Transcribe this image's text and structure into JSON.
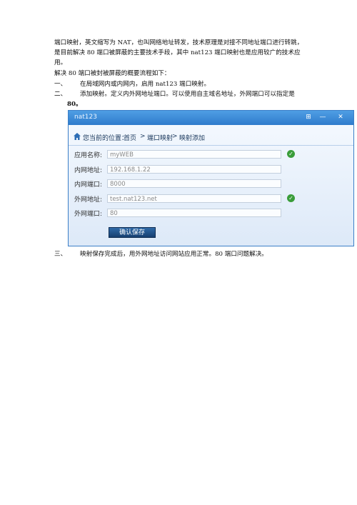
{
  "document": {
    "paragraphs": [
      "端口映射，英文缩写为 NAT，也叫网络地址转发，技术原理是对接不同地址端口进行转跳，",
      "是目前解决 80 端口被屏蔽的主要技术手段，其中 nat123 端口映射也是应用较广的技术应",
      "用。",
      "解决 80 端口被封被屏蔽的概要流程如下："
    ],
    "steps": [
      {
        "num": "一、",
        "text": "在局域网内或内网内，启用 nat123 端口映射。"
      },
      {
        "num": "二、",
        "text": "添加映射。定义内外网地址端口。可以使用自主域名地址，外网端口可以指定是",
        "cont": "80。"
      },
      {
        "num": "三、",
        "text": "映射保存完成后，用外网地址访问网站应用正常。80 端口问题解决。"
      }
    ]
  },
  "window": {
    "title": "nat123",
    "breadcrumb": {
      "prefix": "您当前的位置：",
      "items": [
        "首页",
        "端口映射",
        "映射添加"
      ],
      "separator": ">"
    },
    "form": {
      "fields": [
        {
          "label": "应用名称:",
          "value": "myWEB",
          "valid": true
        },
        {
          "label": "内网地址:",
          "value": "192.168.1.22",
          "valid": false
        },
        {
          "label": "内网端口:",
          "value": "8000",
          "valid": false
        },
        {
          "label": "外网地址:",
          "value": "test.nat123.net",
          "valid": true
        },
        {
          "label": "外网端口:",
          "value": "80",
          "valid": false
        }
      ],
      "save_label": "确认保存"
    }
  },
  "colors": {
    "accent": "#2f7ccc",
    "check": "#3a9d3a",
    "button": "#1f4f86"
  }
}
